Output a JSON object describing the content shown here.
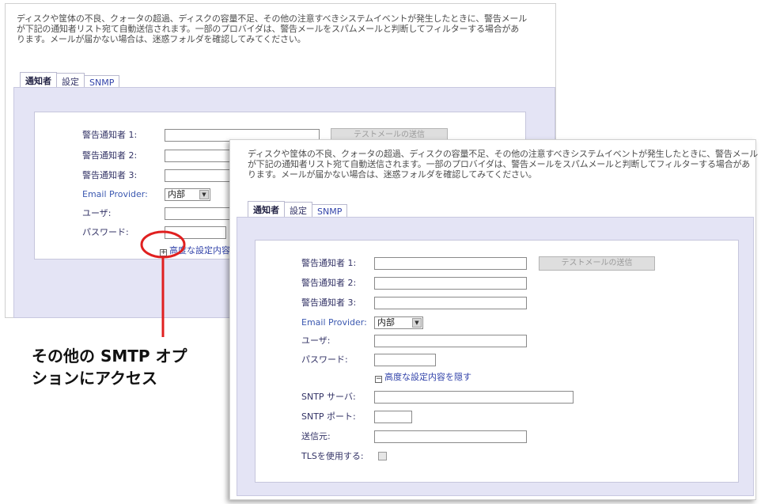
{
  "description_lines": [
    "ディスクや筐体の不良、クォータの超過、ディスクの容量不足、その他の注意すべきシステムイベントが発生したときに、警告メール",
    "が下記の通知者リスト宛て自動送信されます。一部のプロバイダは、警告メールをスパムメールと判断してフィルターする場合があ",
    "ります。メールが届かない場合は、迷惑フォルダを確認してみてください。"
  ],
  "tabs": [
    "通知者",
    "設定",
    "SNMP"
  ],
  "form": {
    "notifier1_label": "警告通知者 1:",
    "notifier2_label": "警告通知者 2:",
    "notifier3_label": "警告通知者 3:",
    "email_provider_label": "Email Provider:",
    "email_provider_value": "内部",
    "user_label": "ユーザ:",
    "password_label": "パスワード:",
    "test_mail_button": "テストメールの送信",
    "advanced_show": "高度な設定内容",
    "advanced_hide": "高度な設定内容を隠す",
    "smtp_server_label": "SNTP サーバ:",
    "smtp_port_label": "SNTP ポート:",
    "sender_label": "送信元:",
    "tls_label": "TLSを使用する:"
  },
  "callout_lines": [
    "その他の SMTP オプ",
    "ションにアクセス"
  ],
  "colors": {
    "callout_circle": "#e02020",
    "panel_bg": "#e4e4f5"
  }
}
